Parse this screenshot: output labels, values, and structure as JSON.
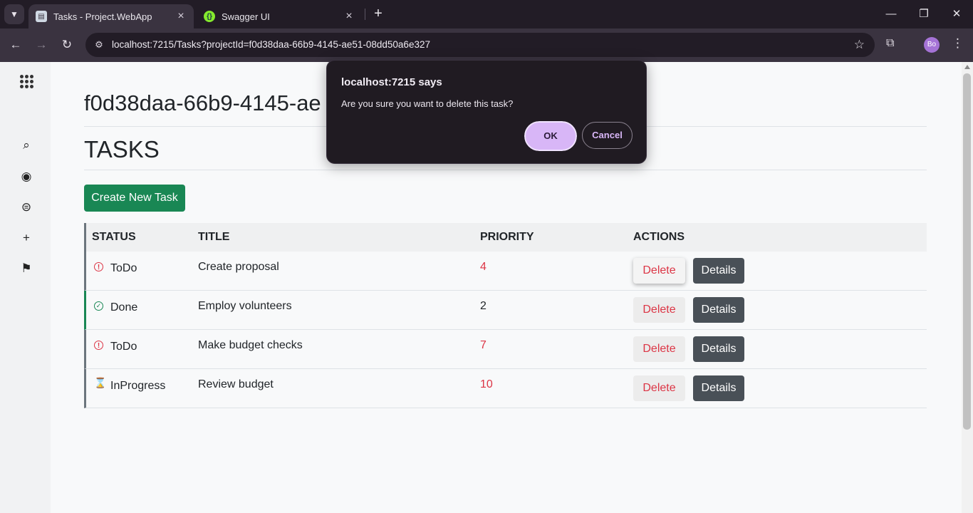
{
  "browser": {
    "tabs": [
      {
        "title": "Tasks - Project.WebApp",
        "active": true
      },
      {
        "title": "Swagger UI",
        "active": false
      }
    ],
    "url": "localhost:7215/Tasks?projectId=f0d38daa-66b9-4145-ae51-08dd50a6e327",
    "profile_initials": "Bo"
  },
  "sidebar": {
    "icons": [
      "apps-grid-icon",
      "search-icon",
      "account-icon",
      "list-icon",
      "add-icon",
      "bookmark-icon"
    ]
  },
  "page": {
    "project_id": "f0d38daa-66b9-4145-ae",
    "heading": "TASKS",
    "create_button": "Create New Task"
  },
  "table": {
    "headers": [
      "STATUS",
      "TITLE",
      "PRIORITY",
      "ACTIONS"
    ],
    "rows": [
      {
        "status": "ToDo",
        "title": "Create proposal",
        "priority": "4",
        "delete": "Delete",
        "details": "Details"
      },
      {
        "status": "Done",
        "title": "Employ volunteers",
        "priority": "2",
        "delete": "Delete",
        "details": "Details"
      },
      {
        "status": "ToDo",
        "title": "Make budget checks",
        "priority": "7",
        "delete": "Delete",
        "details": "Details"
      },
      {
        "status": "InProgress",
        "title": "Review budget",
        "priority": "10",
        "delete": "Delete",
        "details": "Details"
      }
    ]
  },
  "dialog": {
    "title": "localhost:7215 says",
    "message": "Are you sure you want to delete this task?",
    "ok": "OK",
    "cancel": "Cancel"
  },
  "colors": {
    "success": "#198754",
    "danger": "#dc3545",
    "secondary": "#495057",
    "dialog_accent": "#d8b6f7"
  }
}
